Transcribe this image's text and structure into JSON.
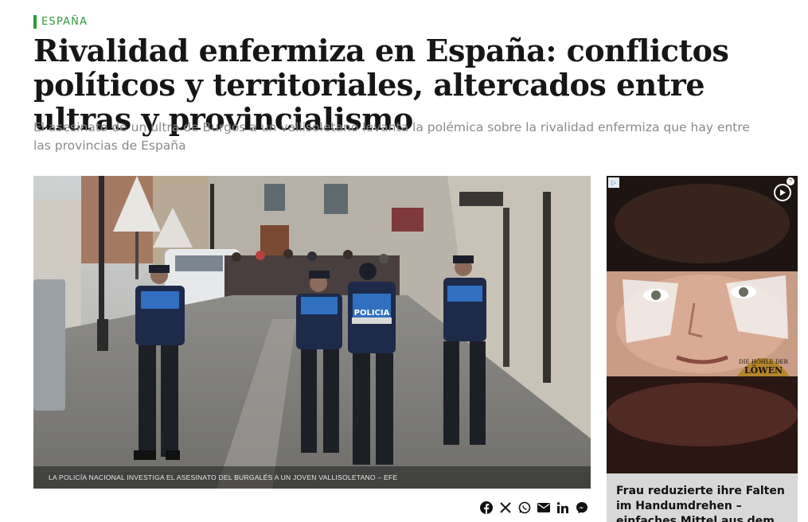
{
  "section": {
    "label": "ESPAÑA",
    "color": "#2e9a3a"
  },
  "article": {
    "headline": "Rivalidad enfermiza en España: conflictos políticos y territoriales, altercados entre ultras y provincialismo",
    "subtitle": "El asesinato de un ultra de Burgos a un vallisoletano levanta la polémica sobre la rivalidad enfermiza que hay entre las provincias de España",
    "photo_caption": "LA POLICÍA NACIONAL INVESTIGA EL ASESINATO DEL BURGALÉS A UN JOVEN VALLISOLETANO – EFE",
    "photo_vest_label": "POLICIA"
  },
  "share": {
    "icons": [
      "facebook-icon",
      "x-icon",
      "whatsapp-icon",
      "email-icon",
      "linkedin-icon",
      "messenger-icon"
    ]
  },
  "ad": {
    "headline": "Frau reduzierte ihre Falten im Handumdrehen – einfaches Mittel aus dem",
    "brand_line1": "DIE HÖHLE DER",
    "brand_line2": "LÖWEN",
    "adchoices_glyph": "▷",
    "info_glyph": "?"
  }
}
